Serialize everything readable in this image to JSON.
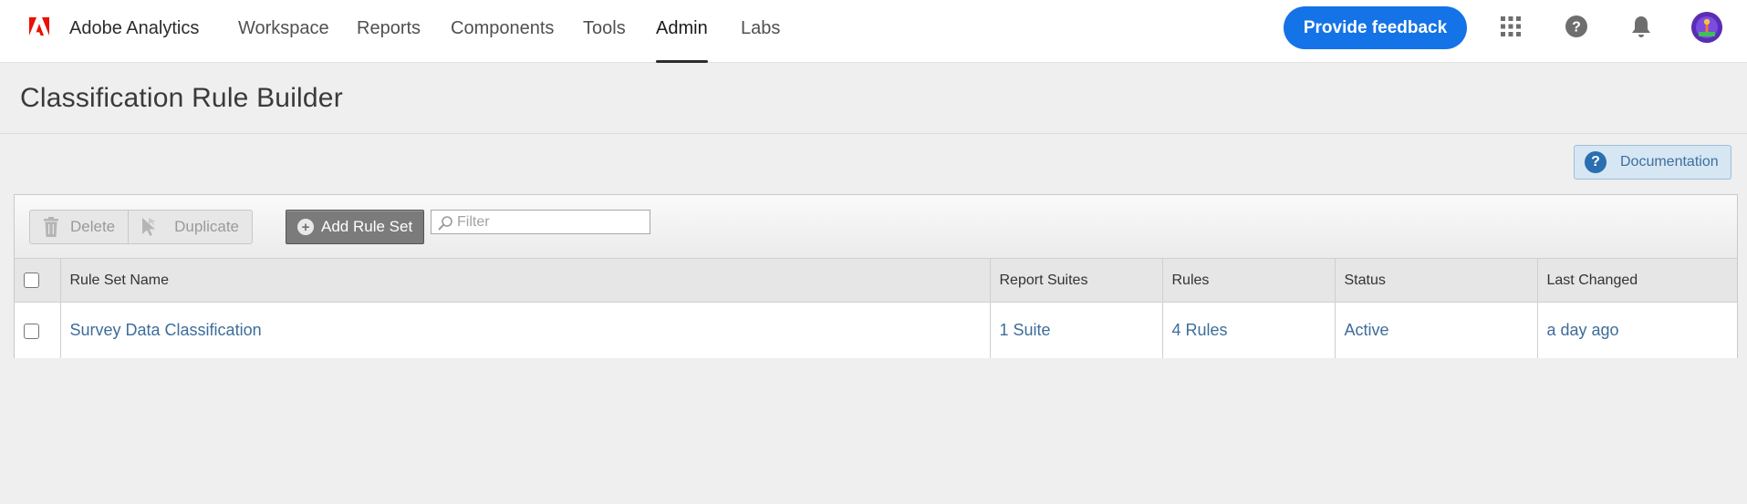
{
  "app": {
    "title": "Adobe Analytics",
    "brand_color": "#eb1000"
  },
  "nav": {
    "tabs": [
      {
        "label": "Workspace",
        "active": false
      },
      {
        "label": "Reports",
        "active": false
      },
      {
        "label": "Components",
        "active": false
      },
      {
        "label": "Tools",
        "active": false
      },
      {
        "label": "Admin",
        "active": true
      },
      {
        "label": "Labs",
        "active": false
      }
    ],
    "feedback_label": "Provide feedback",
    "icons": [
      "apps-grid-icon",
      "help-icon",
      "bell-icon",
      "avatar"
    ]
  },
  "page": {
    "title": "Classification Rule Builder",
    "documentation_label": "Documentation"
  },
  "toolbar": {
    "delete_label": "Delete",
    "duplicate_label": "Duplicate",
    "add_label": "Add Rule Set",
    "filter_placeholder": "Filter"
  },
  "table": {
    "columns": [
      "Rule Set Name",
      "Report Suites",
      "Rules",
      "Status",
      "Last Changed"
    ],
    "rows": [
      {
        "name": "Survey Data Classification",
        "suites": "1 Suite",
        "rules": "4 Rules",
        "status": "Active",
        "changed": "a day ago"
      }
    ]
  },
  "colors": {
    "accent": "#1473e6",
    "link": "#3d6d9a"
  }
}
